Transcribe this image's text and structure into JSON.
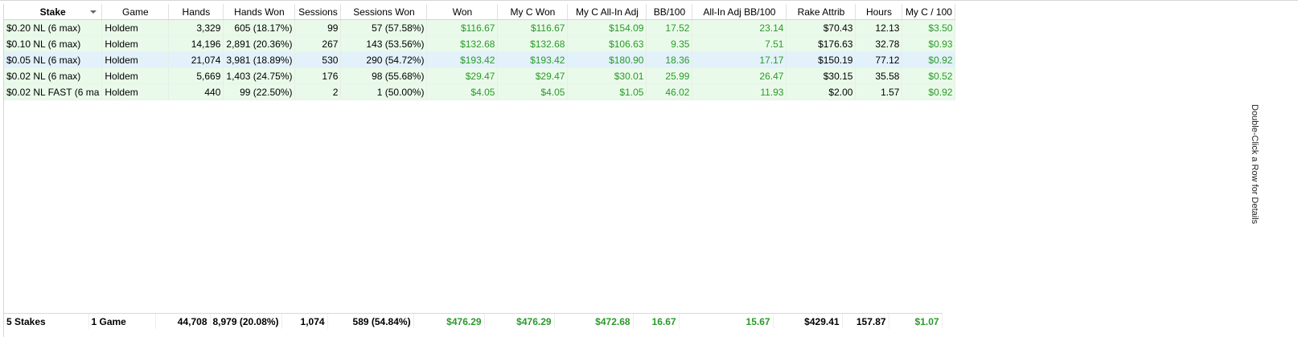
{
  "columns": [
    "Stake",
    "Game",
    "Hands",
    "Hands Won",
    "Sessions",
    "Sessions Won",
    "Won",
    "My C Won",
    "My C All-In Adj",
    "BB/100",
    "All-In Adj BB/100",
    "Rake Attrib",
    "Hours",
    "My C / 100"
  ],
  "rows": [
    [
      "$0.20 NL (6 max)",
      "Holdem",
      "3,329",
      "605 (18.17%)",
      "99",
      "57 (57.58%)",
      "$116.67",
      "$116.67",
      "$154.09",
      "17.52",
      "23.14",
      "$70.43",
      "12.13",
      "$3.50"
    ],
    [
      "$0.10 NL (6 max)",
      "Holdem",
      "14,196",
      "2,891 (20.36%)",
      "267",
      "143 (53.56%)",
      "$132.68",
      "$132.68",
      "$106.63",
      "9.35",
      "7.51",
      "$176.63",
      "32.78",
      "$0.93"
    ],
    [
      "$0.05 NL (6 max)",
      "Holdem",
      "21,074",
      "3,981 (18.89%)",
      "530",
      "290 (54.72%)",
      "$193.42",
      "$193.42",
      "$180.90",
      "18.36",
      "17.17",
      "$150.19",
      "77.12",
      "$0.92"
    ],
    [
      "$0.02 NL (6 max)",
      "Holdem",
      "5,669",
      "1,403 (24.75%)",
      "176",
      "98 (55.68%)",
      "$29.47",
      "$29.47",
      "$30.01",
      "25.99",
      "26.47",
      "$30.15",
      "35.58",
      "$0.52"
    ],
    [
      "$0.02 NL FAST (6 ma",
      "Holdem",
      "440",
      "99 (22.50%)",
      "2",
      "1 (50.00%)",
      "$4.05",
      "$4.05",
      "$1.05",
      "46.02",
      "11.93",
      "$2.00",
      "1.57",
      "$0.92"
    ]
  ],
  "totals": [
    "5 Stakes",
    "1 Game",
    "44,708",
    "8,979 (20.08%)",
    "1,074",
    "589 (54.84%)",
    "$476.29",
    "$476.29",
    "$472.68",
    "16.67",
    "15.67",
    "$429.41",
    "157.87",
    "$1.07"
  ],
  "side_hint": "Double-Click a Row for Details",
  "colors": {
    "positive": "#2a9a2a",
    "row_bg": "#eafaea",
    "selected_bg": "#e2f1fa"
  }
}
